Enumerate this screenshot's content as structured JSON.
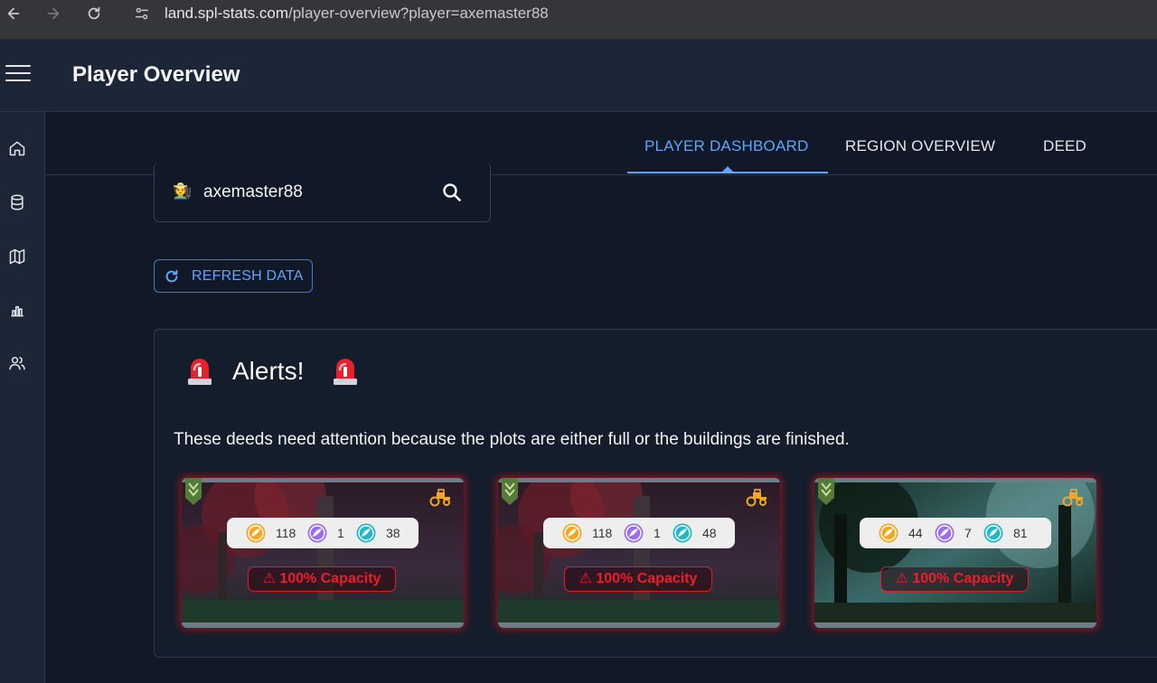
{
  "browser": {
    "url_host": "land.spl-stats.com",
    "url_path": "/player-overview?player=axemaster88"
  },
  "header": {
    "title": "Player Overview"
  },
  "sidebar": {
    "items": [
      {
        "icon": "home-icon"
      },
      {
        "icon": "database-icon"
      },
      {
        "icon": "map-icon"
      },
      {
        "icon": "bar-chart-icon"
      },
      {
        "icon": "users-icon"
      }
    ]
  },
  "tabs": [
    {
      "label": "PLAYER DASHBOARD",
      "active": true
    },
    {
      "label": "REGION OVERVIEW",
      "active": false
    },
    {
      "label": "DEED",
      "active": false
    }
  ],
  "search": {
    "player_emoji": "🧑‍🌾",
    "value": "axemaster88"
  },
  "refresh": {
    "label": "REFRESH DATA"
  },
  "alerts": {
    "title": "Alerts!",
    "siren_emoji": "🚨",
    "description": "These deeds need attention because the plots are either full or the buildings are finished.",
    "cards": [
      {
        "resources": [
          "118",
          "1",
          "38"
        ],
        "capacity": "⚠ 100% Capacity",
        "scene": "autumn"
      },
      {
        "resources": [
          "118",
          "1",
          "48"
        ],
        "capacity": "⚠ 100% Capacity",
        "scene": "autumn"
      },
      {
        "resources": [
          "44",
          "7",
          "81"
        ],
        "capacity": "⚠ 100% Capacity",
        "scene": "forest"
      }
    ]
  },
  "colors": {
    "accent": "#60a5fa",
    "alert_red": "#ef1c2c",
    "resource_orange": "#f5a623",
    "resource_purple": "#9b6cf0",
    "resource_teal": "#1fb8c9"
  }
}
